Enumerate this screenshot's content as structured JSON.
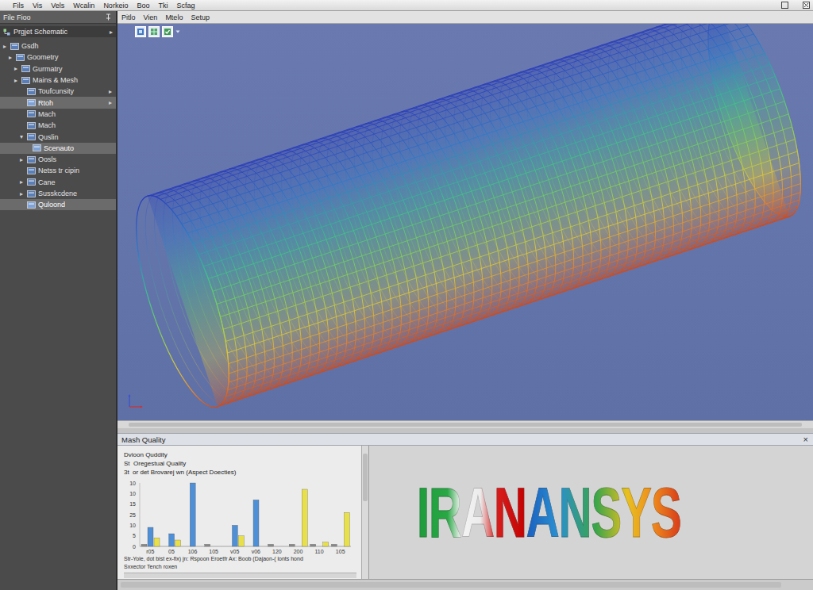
{
  "menubar": {
    "items": [
      "Fils",
      "Vis",
      "Vels",
      "Wcalin",
      "Norkeio",
      "Boo",
      "Tki",
      "Scfag"
    ]
  },
  "sidebar": {
    "header": "File Fioo",
    "section": {
      "title": "Prgjet Schematic",
      "arrow": "▸"
    },
    "items": [
      {
        "label": "Gsdh",
        "level": 0,
        "toggle": "▸",
        "arrow": null,
        "selected": false
      },
      {
        "label": "Goometry",
        "level": 1,
        "toggle": "▸",
        "arrow": null,
        "selected": false
      },
      {
        "label": "Gurmatry",
        "level": 2,
        "toggle": "▸",
        "arrow": null,
        "selected": false
      },
      {
        "label": "Mains & Mesh",
        "level": 2,
        "toggle": "▸",
        "arrow": null,
        "selected": false
      },
      {
        "label": "Toufcunsity",
        "level": 3,
        "toggle": null,
        "arrow": "▸",
        "selected": false
      },
      {
        "label": "Rtoh",
        "level": 3,
        "toggle": null,
        "arrow": "▸",
        "selected": true
      },
      {
        "label": "Mach",
        "level": 3,
        "toggle": null,
        "arrow": null,
        "selected": false
      },
      {
        "label": "Mach",
        "level": 3,
        "toggle": null,
        "arrow": null,
        "selected": false
      },
      {
        "label": "Quslin",
        "level": 3,
        "toggle": "▾",
        "arrow": null,
        "selected": false
      },
      {
        "label": "Scenauto",
        "level": 4,
        "toggle": null,
        "arrow": null,
        "selected": true
      },
      {
        "label": "Oosls",
        "level": 3,
        "toggle": "▸",
        "arrow": null,
        "selected": false
      },
      {
        "label": "Netss tr cipin",
        "level": 3,
        "toggle": null,
        "arrow": null,
        "selected": false
      },
      {
        "label": "Cane",
        "level": 3,
        "toggle": "▸",
        "arrow": null,
        "selected": false
      },
      {
        "label": "Susskcdene",
        "level": 3,
        "toggle": "▸",
        "arrow": null,
        "selected": false
      },
      {
        "label": "Quloond",
        "level": 3,
        "toggle": null,
        "arrow": null,
        "selected": true
      }
    ]
  },
  "viewport": {
    "menu": [
      "Pitlo",
      "Vien",
      "Mtelo",
      "Setup"
    ]
  },
  "mesh_quality": {
    "title": "Mash Quality",
    "close": "×",
    "lines": [
      "Dvioon Quddity",
      "St  Oregestual Quality",
      "3t  or det Brovarej wn (Aspect Doecties)"
    ],
    "chart": {
      "y_ticks": [
        "10",
        "10",
        "15",
        "25",
        "10",
        "5",
        "0"
      ],
      "x_labels": [
        "r05",
        "05",
        "106",
        "105",
        "v05",
        "v06",
        "120",
        "200",
        "110",
        "105"
      ],
      "series": [
        {
          "color": "#8a8a8a",
          "values": [
            1,
            0,
            0,
            1,
            0,
            0,
            1,
            1,
            1,
            1
          ]
        },
        {
          "color": "#4f8fd6",
          "values": [
            9,
            6,
            30,
            0,
            10,
            22,
            0,
            0,
            0,
            0
          ]
        },
        {
          "color": "#e8e04a",
          "values": [
            4,
            3,
            0,
            0,
            5,
            0,
            0,
            27,
            2,
            16
          ]
        }
      ]
    },
    "caption": [
      "Str-Yole, dot bist ex-fix) jn: Rspoon Eroetfr Ax: Boob (Dajaon-( lonts hond",
      "Sxxector Tench roxen"
    ]
  },
  "logo": {
    "parts": [
      "IRAN",
      "ANSYS"
    ]
  }
}
